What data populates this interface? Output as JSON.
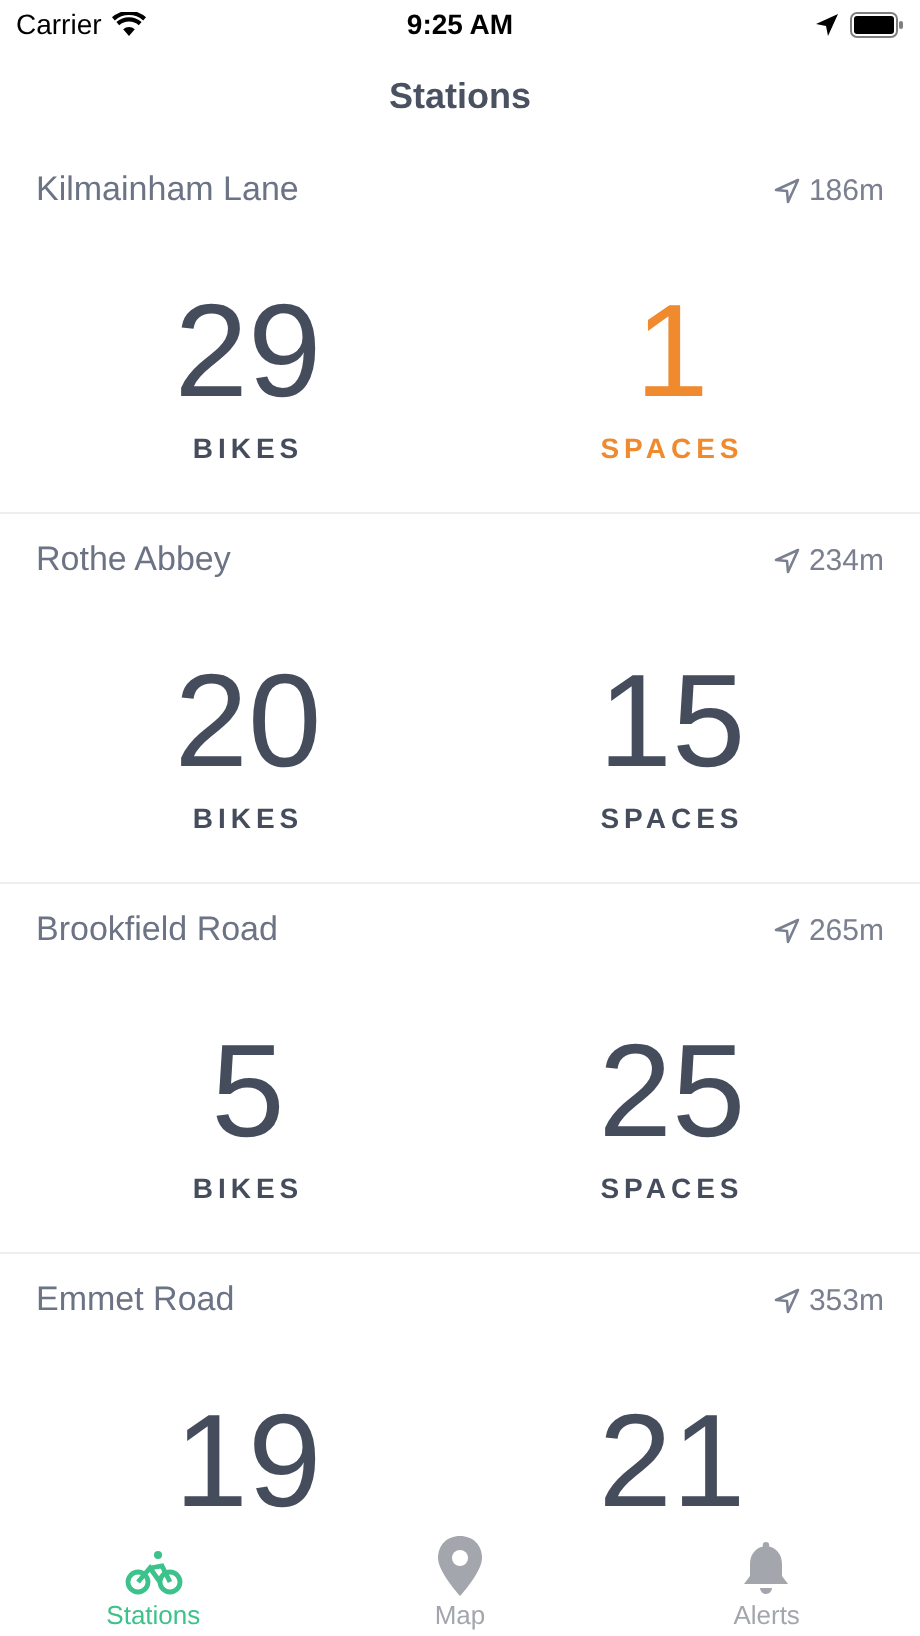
{
  "status_bar": {
    "carrier": "Carrier",
    "time": "9:25 AM"
  },
  "title": "Stations",
  "stations": [
    {
      "name": "Kilmainham Lane",
      "distance": "186m",
      "bikes": {
        "count": "29",
        "label": "BIKES",
        "warning": false
      },
      "spaces": {
        "count": "1",
        "label": "SPACES",
        "warning": true
      }
    },
    {
      "name": "Rothe Abbey",
      "distance": "234m",
      "bikes": {
        "count": "20",
        "label": "BIKES",
        "warning": false
      },
      "spaces": {
        "count": "15",
        "label": "SPACES",
        "warning": false
      }
    },
    {
      "name": "Brookfield Road",
      "distance": "265m",
      "bikes": {
        "count": "5",
        "label": "BIKES",
        "warning": false
      },
      "spaces": {
        "count": "25",
        "label": "SPACES",
        "warning": false
      }
    },
    {
      "name": "Emmet Road",
      "distance": "353m",
      "bikes": {
        "count": "19",
        "warning": false
      },
      "spaces": {
        "count": "21",
        "warning": false
      }
    }
  ],
  "tabs": [
    {
      "kind": "bike",
      "label": "Stations",
      "selected": true
    },
    {
      "kind": "pin",
      "label": "Map",
      "selected": false
    },
    {
      "kind": "bell",
      "label": "Alerts",
      "selected": false
    }
  ]
}
